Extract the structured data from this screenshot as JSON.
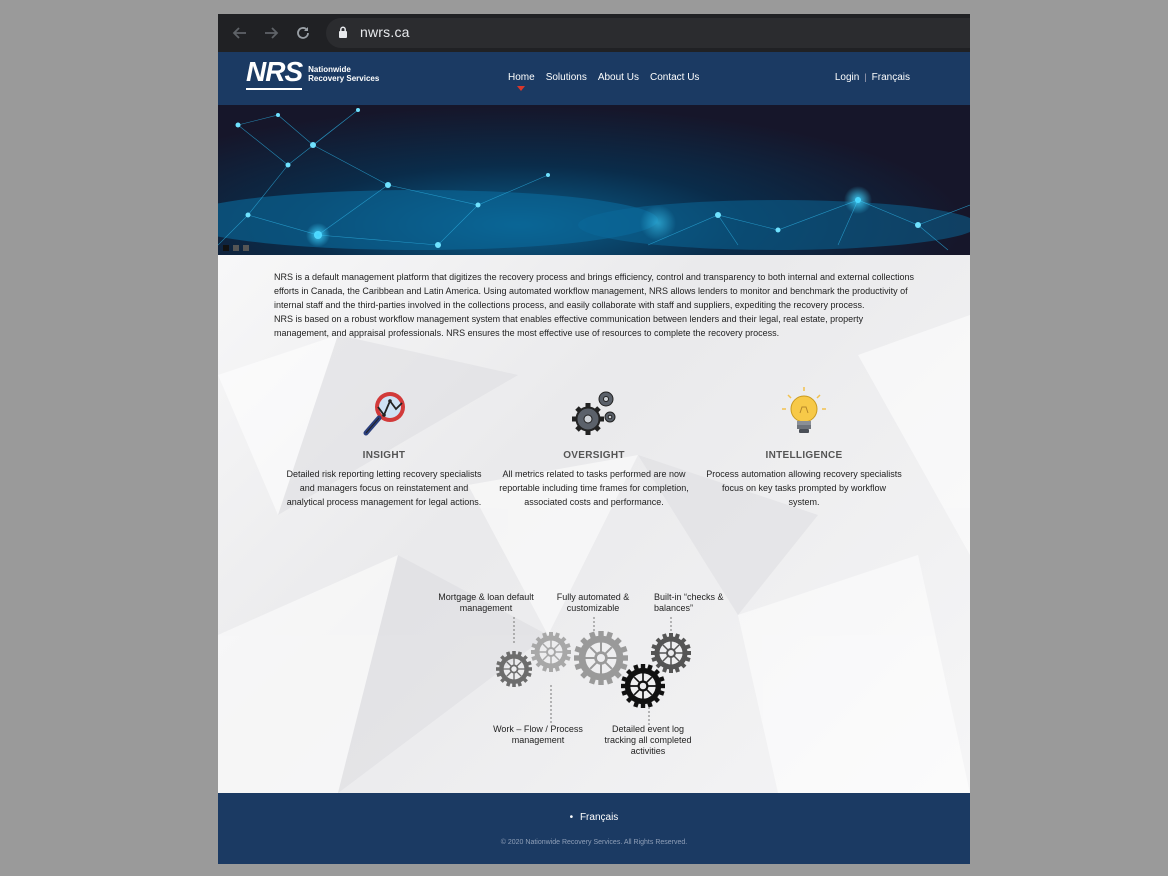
{
  "browser": {
    "url": "nwrs.ca"
  },
  "header": {
    "logo_mark": "NRS",
    "logo_line1": "Nationwide",
    "logo_line2": "Recovery Services",
    "menu": [
      "Home",
      "Solutions",
      "About Us",
      "Contact Us"
    ],
    "active_menu": "Home",
    "login": "Login",
    "language": "Français"
  },
  "intro": {
    "p1": "NRS is a default management platform that digitizes the recovery process and brings efficiency, control and transparency to both internal and external collections efforts in Canada, the Caribbean and Latin America. Using automated workflow management, NRS allows lenders to monitor and benchmark the productivity of internal staff and the third-parties involved in the collections process, and easily collaborate with staff and suppliers, expediting the recovery process.",
    "p2": "NRS is based on a robust workflow management system that enables effective communication between lenders and their legal, real estate, property management, and appraisal professionals. NRS ensures the most effective use of resources to complete the recovery process."
  },
  "features": [
    {
      "icon": "magnifier-chart-icon",
      "title": "INSIGHT",
      "desc": "Detailed risk reporting letting recovery specialists and managers focus on reinstatement and analytical process management for legal actions."
    },
    {
      "icon": "gears-icon",
      "title": "OVERSIGHT",
      "desc": "All metrics related to tasks performed are now reportable including time frames for completion, associated costs and performance."
    },
    {
      "icon": "lightbulb-icon",
      "title": "INTELLIGENCE",
      "desc": "Process automation allowing recovery specialists focus on key tasks prompted by workflow system."
    }
  ],
  "gear_labels": {
    "mortgage": "Mortgage & loan default management",
    "automated": "Fully automated & customizable",
    "checks": "Built-in “checks & balances”",
    "workflow": "Work – Flow / Process management",
    "eventlog": "Detailed event log tracking all completed activities"
  },
  "footer": {
    "language": "Français",
    "copyright": "© 2020 Nationwide Recovery Services. All Rights Reserved."
  },
  "colors": {
    "navy": "#1b3a63",
    "accent_red": "#d9372b"
  }
}
